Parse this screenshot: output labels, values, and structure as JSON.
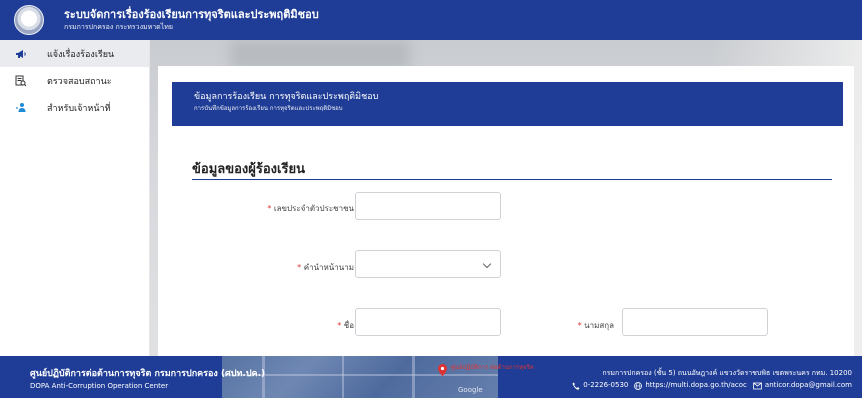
{
  "header": {
    "title": "ระบบจัดการเรื่องร้องเรียนการทุจริตและประพฤติมิชอบ",
    "subtitle": "กรมการปกครอง กระทรวงมหาดไทย"
  },
  "sidebar": {
    "items": [
      {
        "label": "แจ้งเรื่องร้องเรียน",
        "icon": "megaphone-icon",
        "active": true
      },
      {
        "label": "ตรวจสอบสถานะ",
        "icon": "document-search-icon",
        "active": false
      },
      {
        "label": "สำหรับเจ้าหน้าที่",
        "icon": "staff-icon",
        "active": false
      }
    ]
  },
  "card": {
    "title": "ข้อมูลการร้องเรียน การทุจริตและประพฤติมิชอบ",
    "subtitle": "การบันทึกข้อมูลการร้องเรียน การทุจริตและประพฤติมิชอบ"
  },
  "form": {
    "section_title": "ข้อมูลของผู้ร้องเรียน",
    "required_mark": "*",
    "id_label": "เลขประจำตัวประชาชน",
    "id_value": "",
    "prefix_label": "คำนำหน้านาม",
    "prefix_value": "",
    "firstname_label": "ชื่อ",
    "firstname_value": "",
    "lastname_label": "นามสกุล",
    "lastname_value": ""
  },
  "footer": {
    "org_name": "ศูนย์ปฏิบัติการต่อต้านการทุจริต กรมการปกครอง (ศปท.ปค.)",
    "org_eng": "DOPA Anti-Corruption Operation Center",
    "address": "กรมการปกครอง (ชั้น 5) ถนนอัษฎางค์ แขวงวัดราชบพิธ เขตพระนคร กทม. 10200",
    "phone": "0-2226-0530",
    "website": "https://multi.dopa.go.th/acoc",
    "email": "anticor.dopa@gmail.com",
    "map_label": "ศูนย์ปฏิบัติการ ต่อต้านการทุจริต",
    "map_provider": "Google"
  },
  "colors": {
    "primary": "#1f3d96",
    "required": "#dd3333",
    "sidebar_active": "#e9ebee"
  }
}
